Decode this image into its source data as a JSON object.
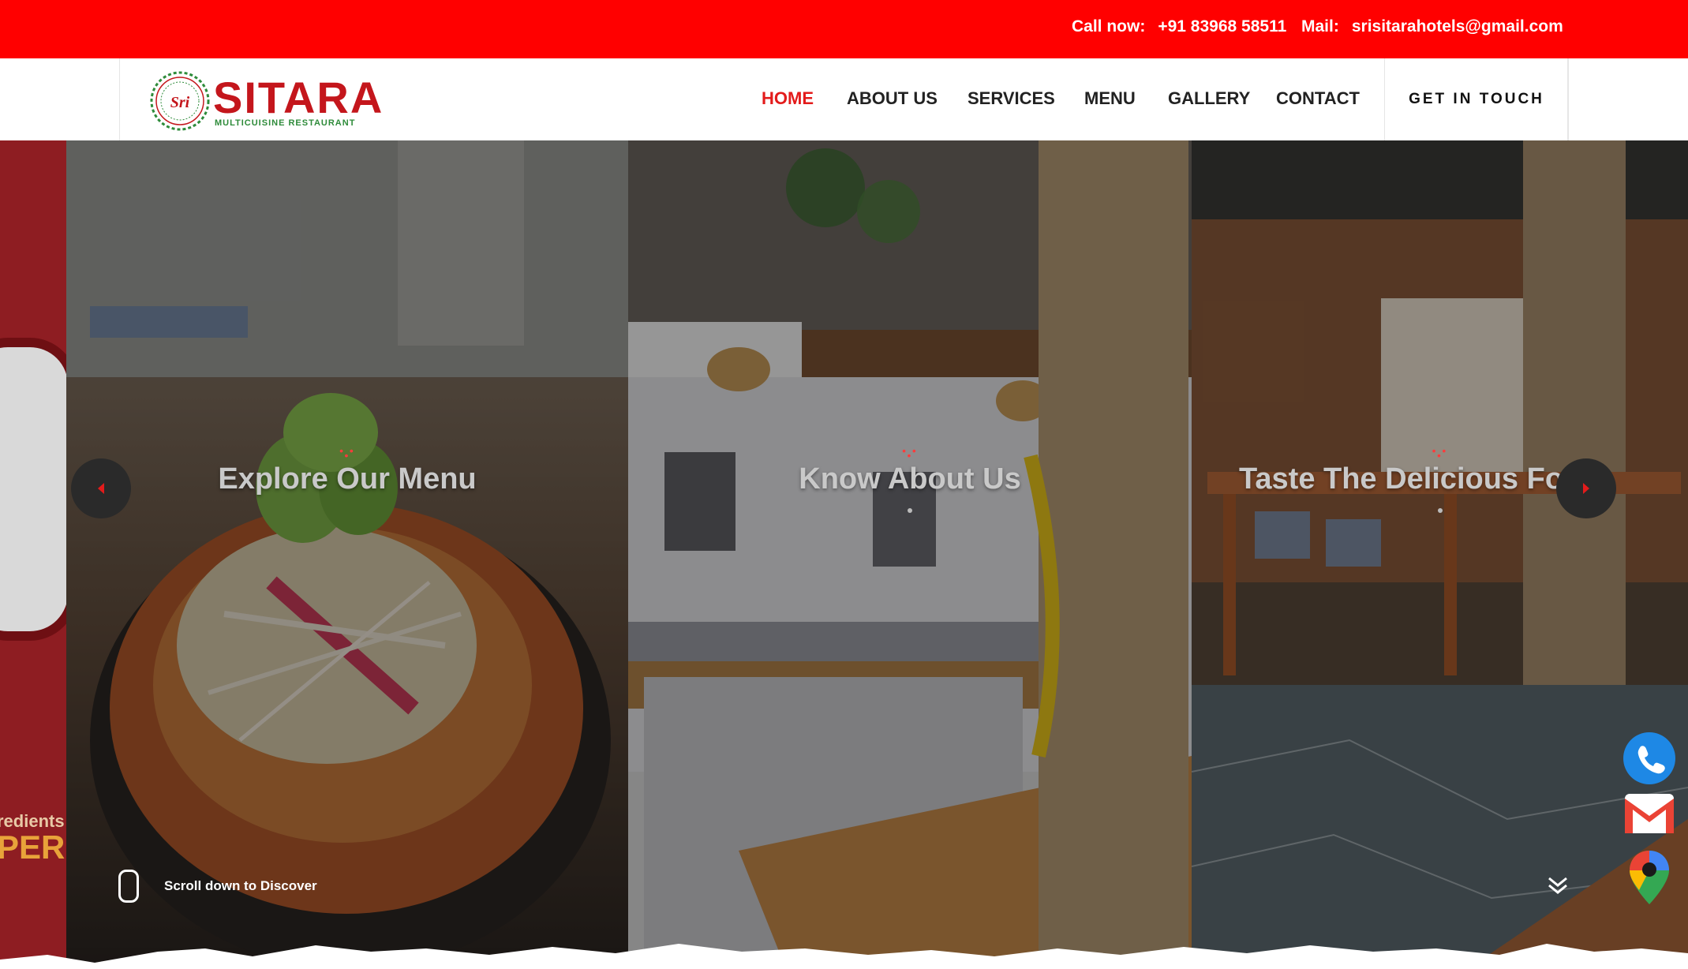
{
  "topbar": {
    "call_label": "Call now:",
    "call_value": "+91 83968 58511",
    "mail_label": "Mail:",
    "mail_value": "srisitarahotels@gmail.com",
    "bg": "#ff0000"
  },
  "brand": {
    "badge_text": "Sri",
    "name": "SITARA",
    "tagline": "MULTICUISINE RESTAURANT",
    "color": "#c4161c"
  },
  "nav": {
    "items": [
      {
        "label": "HOME",
        "active": true
      },
      {
        "label": "ABOUT US",
        "active": false
      },
      {
        "label": "SERVICES",
        "active": false
      },
      {
        "label": "MENU",
        "active": false
      },
      {
        "label": "GALLERY",
        "active": false
      },
      {
        "label": "CONTACT",
        "active": false
      }
    ],
    "cta": "GET IN TOUCH",
    "accent": "#e31b1b"
  },
  "hero": {
    "slides": [
      {
        "title": "Explore Our Menu",
        "image": "food-bowl-photo"
      },
      {
        "title": "Know About Us",
        "image": "restaurant-interior-photo"
      },
      {
        "title": "Taste The Delicious Food",
        "image": "dining-hall-photo"
      }
    ],
    "side_banner": {
      "line1": "redients",
      "line2": "PERI"
    },
    "scroll_text": "Scroll down to Discover"
  },
  "floating": {
    "icons": [
      "phone-icon",
      "gmail-icon",
      "maps-pin-icon"
    ]
  }
}
